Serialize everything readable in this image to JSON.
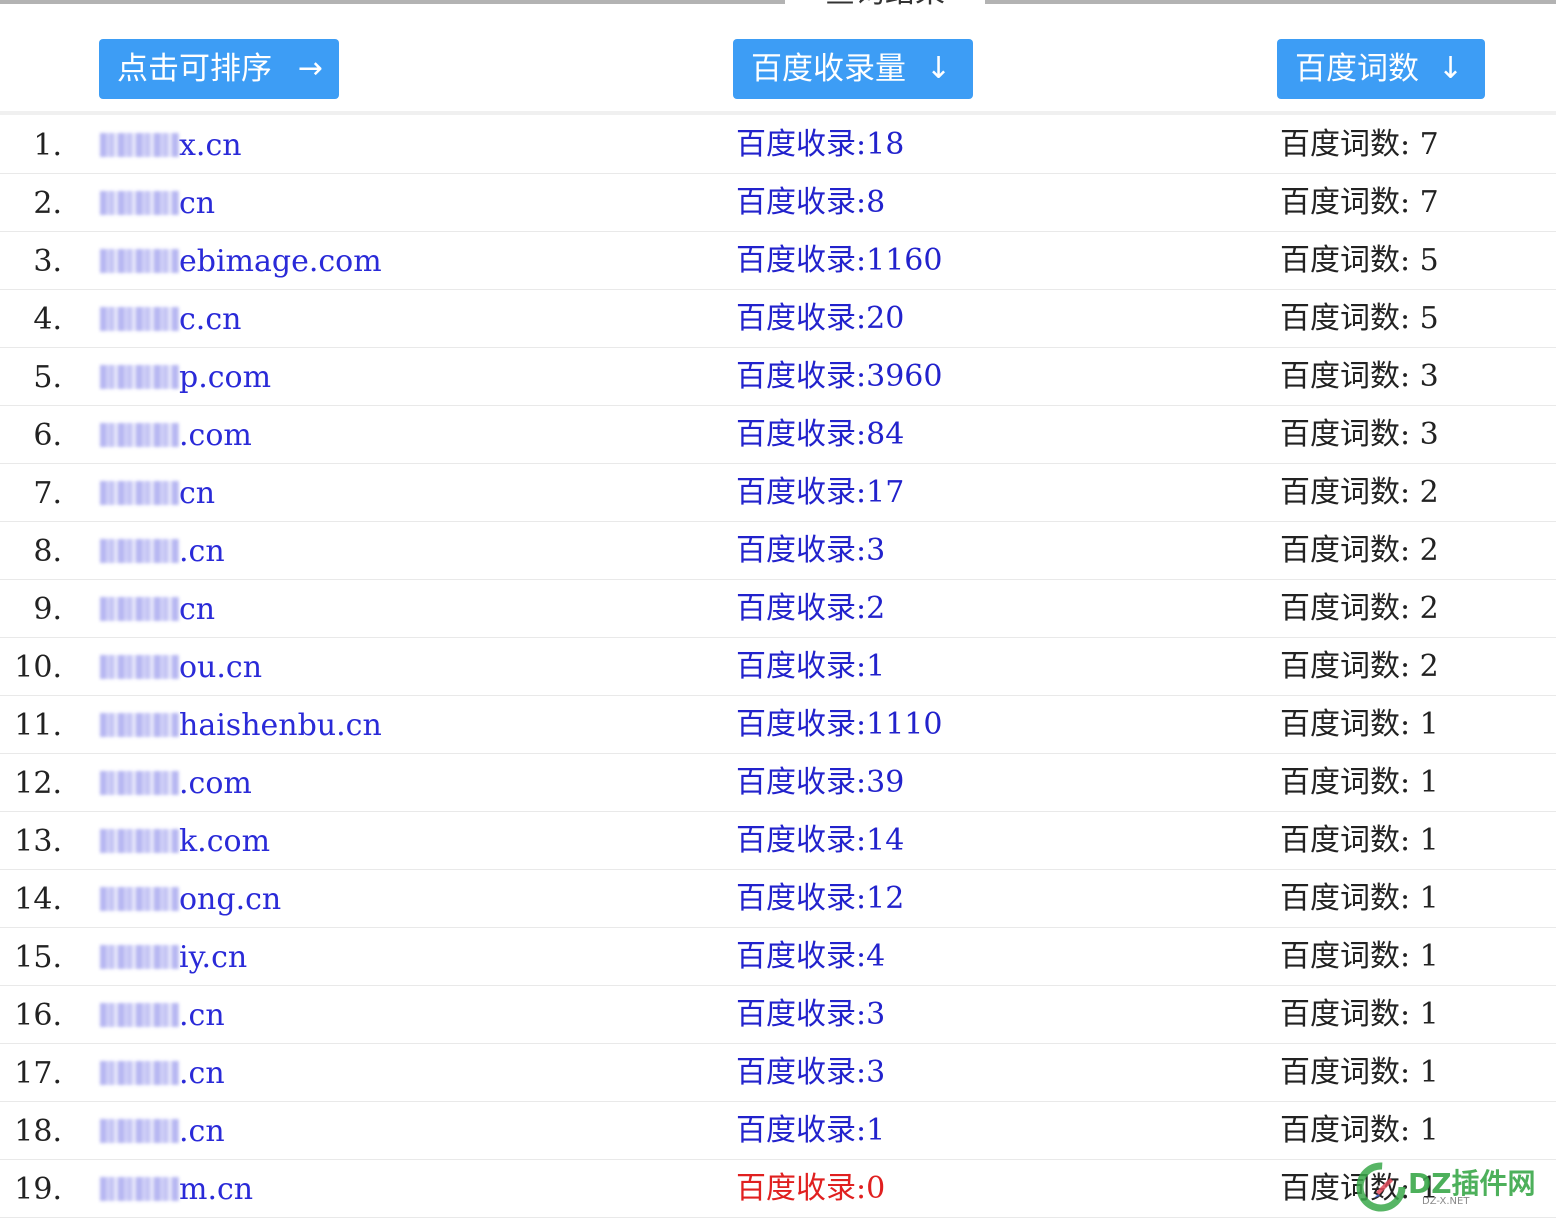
{
  "header": {
    "legend": "查询结果",
    "sort_buttons": [
      {
        "label": "点击可排序",
        "arrow": "→"
      },
      {
        "label": "百度收录量",
        "arrow": "↓"
      },
      {
        "label": "百度词数",
        "arrow": "↓"
      }
    ]
  },
  "rows": [
    {
      "num": "1.",
      "domain": "x.cn",
      "baidu": "百度收录:18",
      "words": "百度词数: 7"
    },
    {
      "num": "2.",
      "domain": "cn",
      "baidu": "百度收录:8",
      "words": "百度词数: 7"
    },
    {
      "num": "3.",
      "domain": "ebimage.com",
      "baidu": "百度收录:1160",
      "words": "百度词数: 5"
    },
    {
      "num": "4.",
      "domain": "c.cn",
      "baidu": "百度收录:20",
      "words": "百度词数: 5"
    },
    {
      "num": "5.",
      "domain": "p.com",
      "baidu": "百度收录:3960",
      "words": "百度词数: 3"
    },
    {
      "num": "6.",
      "domain": ".com",
      "baidu": "百度收录:84",
      "words": "百度词数: 3"
    },
    {
      "num": "7.",
      "domain": "cn",
      "baidu": "百度收录:17",
      "words": "百度词数: 2"
    },
    {
      "num": "8.",
      "domain": ".cn",
      "baidu": "百度收录:3",
      "words": "百度词数: 2"
    },
    {
      "num": "9.",
      "domain": "cn",
      "baidu": "百度收录:2",
      "words": "百度词数: 2"
    },
    {
      "num": "10.",
      "domain": "ou.cn",
      "baidu": "百度收录:1",
      "words": "百度词数: 2"
    },
    {
      "num": "11.",
      "domain": "haishenbu.cn",
      "baidu": "百度收录:1110",
      "words": "百度词数: 1"
    },
    {
      "num": "12.",
      "domain": ".com",
      "baidu": "百度收录:39",
      "words": "百度词数: 1"
    },
    {
      "num": "13.",
      "domain": "k.com",
      "baidu": "百度收录:14",
      "words": "百度词数: 1"
    },
    {
      "num": "14.",
      "domain": "ong.cn",
      "baidu": "百度收录:12",
      "words": "百度词数: 1"
    },
    {
      "num": "15.",
      "domain": "iy.cn",
      "baidu": "百度收录:4",
      "words": "百度词数: 1"
    },
    {
      "num": "16.",
      "domain": ".cn",
      "baidu": "百度收录:3",
      "words": "百度词数: 1"
    },
    {
      "num": "17.",
      "domain": ".cn",
      "baidu": "百度收录:3",
      "words": "百度词数: 1"
    },
    {
      "num": "18.",
      "domain": ".cn",
      "baidu": "百度收录:1",
      "words": "百度词数: 1"
    },
    {
      "num": "19.",
      "domain": "m.cn",
      "baidu": "百度收录:0",
      "words": "百度词数: 1",
      "zero": true
    }
  ],
  "colors": {
    "button_bg": "#3d9df5",
    "link": "#2a2ad8",
    "baidu_count": "#2222cc",
    "baidu_zero": "#e02020"
  },
  "watermark": {
    "text": "DZ插件网",
    "sub": "DZ-X.NET"
  }
}
